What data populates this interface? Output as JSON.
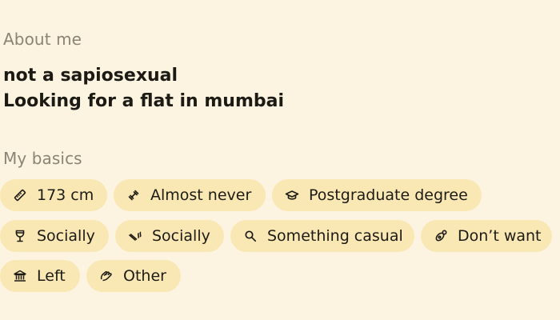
{
  "about": {
    "heading": "About me",
    "bio_lines": [
      "not a sapiosexual",
      "Looking for a flat in mumbai"
    ]
  },
  "basics": {
    "heading": "My basics",
    "rows": [
      [
        {
          "icon": "ruler-icon",
          "label": "173 cm"
        },
        {
          "icon": "dumbbell-icon",
          "label": "Almost never"
        },
        {
          "icon": "graduation-cap-icon",
          "label": "Postgraduate degree"
        }
      ],
      [
        {
          "icon": "wine-glass-icon",
          "label": "Socially"
        },
        {
          "icon": "smoking-icon",
          "label": "Socially"
        },
        {
          "icon": "magnifier-icon",
          "label": "Something casual"
        },
        {
          "icon": "pacifier-icon",
          "label": "Don’t want"
        }
      ],
      [
        {
          "icon": "government-building-icon",
          "label": "Left"
        },
        {
          "icon": "praying-hands-icon",
          "label": "Other"
        }
      ]
    ]
  },
  "colors": {
    "background": "#fcf4e0",
    "chip": "#f9e8b4",
    "heading": "#8a8476",
    "text": "#1c1a15"
  }
}
